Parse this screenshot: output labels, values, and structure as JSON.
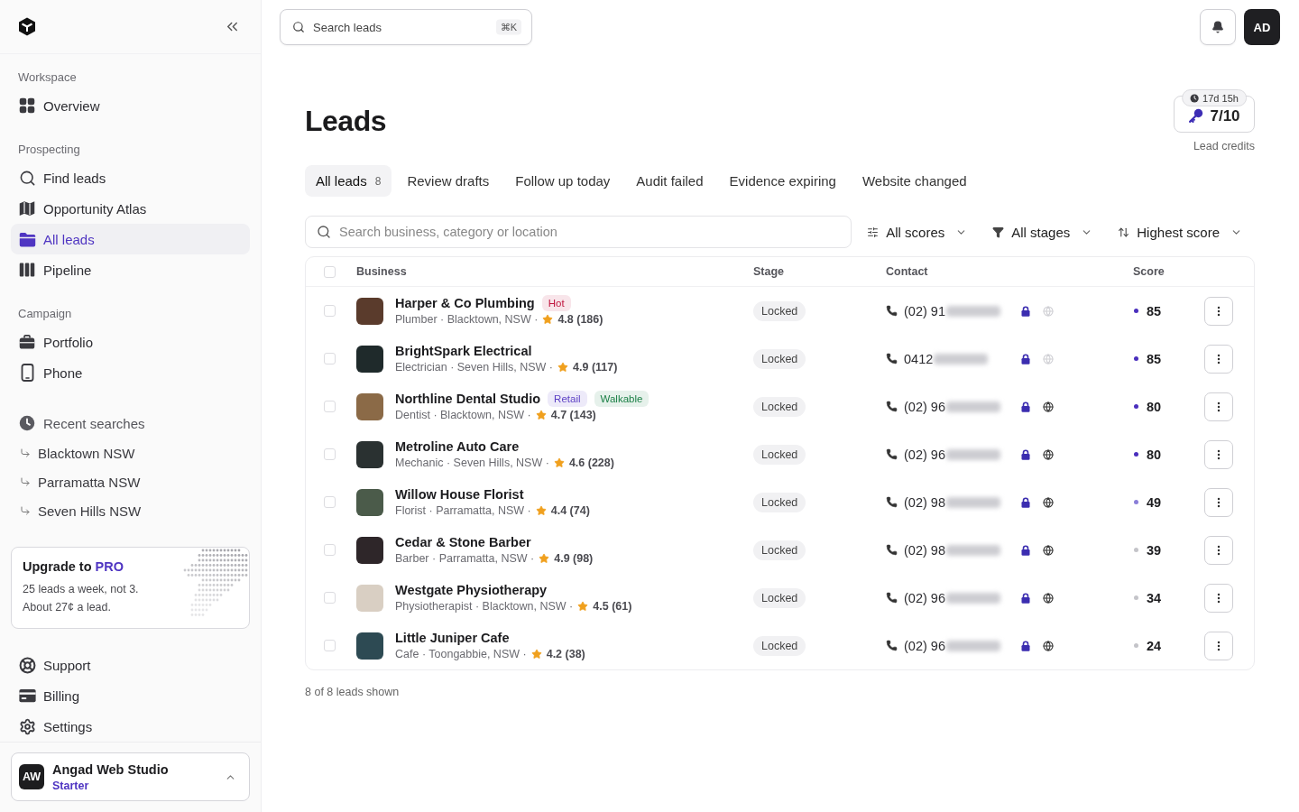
{
  "sidebar": {
    "sections": [
      {
        "label": "Workspace",
        "items": [
          {
            "label": "Overview",
            "selected": false
          }
        ]
      },
      {
        "label": "Prospecting",
        "items": [
          {
            "label": "Find leads",
            "selected": false
          },
          {
            "label": "Opportunity Atlas",
            "selected": false
          },
          {
            "label": "All leads",
            "selected": true
          },
          {
            "label": "Pipeline",
            "selected": false
          }
        ]
      },
      {
        "label": "Campaign",
        "items": [
          {
            "label": "Portfolio",
            "selected": false
          },
          {
            "label": "Phone",
            "selected": false
          }
        ]
      }
    ],
    "recent_searches": {
      "label": "Recent searches",
      "items": [
        "Blacktown NSW",
        "Parramatta NSW",
        "Seven Hills NSW"
      ]
    },
    "upgrade_card": {
      "title": "Upgrade to **PRO**",
      "lines": [
        "25 leads a week, not 3.",
        "About 27¢ a lead."
      ]
    },
    "bottom_items": [
      {
        "label": "Support",
        "selected": false
      },
      {
        "label": "Billing",
        "selected": false
      },
      {
        "label": "Settings",
        "selected": false
      }
    ],
    "account": {
      "initials": "AW",
      "name": "Angad Web Studio",
      "plan": "Starter"
    }
  },
  "top_bar": {
    "search": {
      "placeholder": "Search leads",
      "shortcut": "⌘K"
    },
    "avatar": "AD"
  },
  "page": {
    "title": "Leads",
    "credits": {
      "timer": "17d 15h",
      "value": "7/10",
      "label": "Lead credits"
    }
  },
  "tabs": [
    {
      "label": "All leads",
      "count": "8",
      "selected": true
    },
    {
      "label": "Review drafts",
      "selected": false
    },
    {
      "label": "Follow up today",
      "selected": false
    },
    {
      "label": "Audit failed",
      "selected": false
    },
    {
      "label": "Evidence expiring",
      "selected": false
    },
    {
      "label": "Website changed",
      "selected": false
    }
  ],
  "filters": {
    "search": {
      "placeholder": "Search business, category or location"
    },
    "options": [
      "All scores",
      "All stages",
      "Highest score"
    ]
  },
  "table": {
    "columns": [
      "Business",
      "Stage",
      "Contact",
      "Score"
    ],
    "select_all": {
      "checked": false
    },
    "rows": [
      {
        "checked": false,
        "name": "Harper & Co Plumbing",
        "tags": [
          {
            "label": "Hot",
            "color": "#c0163f"
          }
        ],
        "meta": "Plumber · Blacktown, NSW ·",
        "rating": "4.8 (186)",
        "stage": "Locked",
        "phone": "(02) 91",
        "website_disabled": true,
        "score": {
          "value": "85",
          "color": "#4a2fbd"
        }
      },
      {
        "checked": false,
        "name": "BrightSpark Electrical",
        "tags": [],
        "meta": "Electrician · Seven Hills, NSW ·",
        "rating": "4.9 (117)",
        "stage": "Locked",
        "phone": "0412",
        "website_disabled": true,
        "score": {
          "value": "85",
          "color": "#4a2fbd"
        }
      },
      {
        "checked": false,
        "name": "Northline Dental Studio",
        "tags": [
          {
            "label": "Retail",
            "color": "#5b3fc4"
          },
          {
            "label": "Walkable",
            "color": "#1a7f45"
          }
        ],
        "meta": "Dentist · Blacktown, NSW ·",
        "rating": "4.7 (143)",
        "stage": "Locked",
        "phone": "(02) 96",
        "website_disabled": false,
        "score": {
          "value": "80",
          "color": "#4a2fbd"
        }
      },
      {
        "checked": false,
        "name": "Metroline Auto Care",
        "tags": [],
        "meta": "Mechanic · Seven Hills, NSW ·",
        "rating": "4.6 (228)",
        "stage": "Locked",
        "phone": "(02) 96",
        "website_disabled": false,
        "score": {
          "value": "80",
          "color": "#4a2fbd"
        }
      },
      {
        "checked": false,
        "name": "Willow House Florist",
        "tags": [],
        "meta": "Florist · Parramatta, NSW ·",
        "rating": "4.4 (74)",
        "stage": "Locked",
        "phone": "(02) 98",
        "website_disabled": false,
        "score": {
          "value": "49",
          "color": "#8a7ed8"
        }
      },
      {
        "checked": false,
        "name": "Cedar & Stone Barber",
        "tags": [],
        "meta": "Barber · Parramatta, NSW ·",
        "rating": "4.9 (98)",
        "stage": "Locked",
        "phone": "(02) 98",
        "website_disabled": false,
        "score": {
          "value": "39",
          "color": "#c4c4c9"
        }
      },
      {
        "checked": false,
        "name": "Westgate Physiotherapy",
        "tags": [],
        "meta": "Physiotherapist · Blacktown, NSW ·",
        "rating": "4.5 (61)",
        "stage": "Locked",
        "phone": "(02) 96",
        "website_disabled": false,
        "score": {
          "value": "34",
          "color": "#c4c4c9"
        }
      },
      {
        "checked": false,
        "name": "Little Juniper Cafe",
        "tags": [],
        "meta": "Cafe · Toongabbie, NSW ·",
        "rating": "4.2 (38)",
        "stage": "Locked",
        "phone": "(02) 96",
        "website_disabled": false,
        "score": {
          "value": "24",
          "color": "#c4c4c9"
        }
      }
    ]
  },
  "footer_text": "8 of 8 leads shown"
}
